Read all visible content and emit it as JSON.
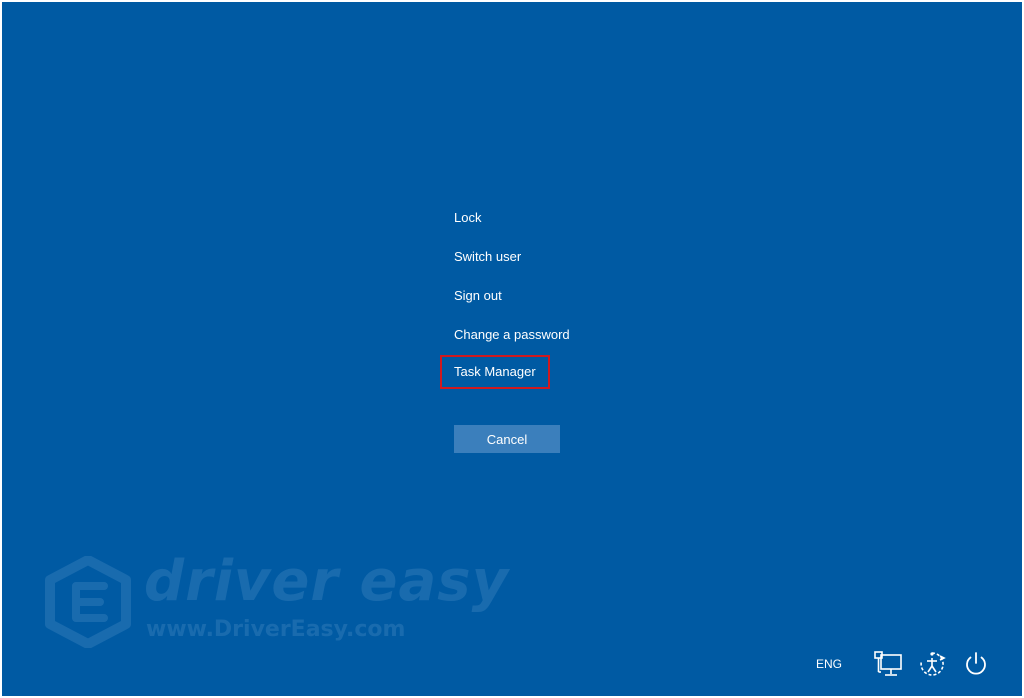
{
  "menu": {
    "items": [
      {
        "label": "Lock"
      },
      {
        "label": "Switch user"
      },
      {
        "label": "Sign out"
      },
      {
        "label": "Change a password"
      },
      {
        "label": "Task Manager",
        "highlighted": true
      }
    ],
    "cancel_label": "Cancel"
  },
  "watermark": {
    "title": "driver easy",
    "url": "www.DriverEasy.com"
  },
  "tray": {
    "language": "ENG",
    "icons": [
      "network-icon",
      "ease-of-access-icon",
      "power-icon"
    ]
  },
  "colors": {
    "background": "#005aa3",
    "button": "#3b7fbc",
    "highlight_border": "#d0191f",
    "text": "#ffffff"
  }
}
